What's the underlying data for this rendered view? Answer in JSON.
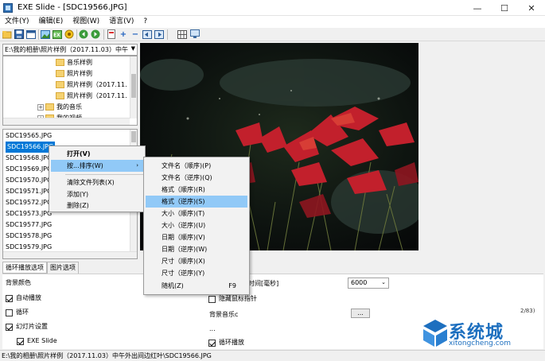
{
  "window": {
    "title": "EXE Slide - [SDC19566.JPG]",
    "minimize": "—",
    "maximize": "☐",
    "close": "✕"
  },
  "menubar": [
    "文件(Y)",
    "编辑(E)",
    "视图(W)",
    "语言(V)",
    "?"
  ],
  "toolbar": {
    "icons": [
      "open-folder-icon",
      "save-icon",
      "window-icon",
      "image-icon",
      "exe-icon",
      "record-icon",
      "back-icon",
      "forward-icon",
      "page-icon",
      "add-icon",
      "remove-icon",
      "move-left-icon",
      "move-right-icon",
      "grid-icon",
      "monitor-icon"
    ]
  },
  "path": {
    "value": "E:\\我的相册\\照片样例（2017.11.03）中午"
  },
  "tree": [
    {
      "label": "音乐样例"
    },
    {
      "label": "照片样例"
    },
    {
      "label": "照片样例（2017.11."
    },
    {
      "label": "照片样例（2017.11."
    },
    {
      "label": "我的音乐"
    },
    {
      "label": "我的视频"
    }
  ],
  "files": [
    "SDC19565.JPG",
    "SDC19566.JPG",
    "SDC19568.JPG",
    "SDC19569.JPG",
    "SDC19570.JPG",
    "SDC19571.JPG",
    "SDC19572.JPG",
    "SDC19573.JPG",
    "SDC19577.JPG",
    "SDC19578.JPG",
    "SDC19579.JPG"
  ],
  "tabs": [
    "循环播放选项",
    "图片选项"
  ],
  "options": {
    "bg_color": "背景颜色",
    "autoplay": "自动播放",
    "loop": "循环",
    "slideshow_settings": "幻灯片设置",
    "exe_slide": "EXE Slide",
    "interval_label": "时间[毫秒]",
    "interval_value": "6000",
    "hide_cursor": "隐藏鼠标指针",
    "bg_music": "背景音乐c",
    "dots": "...",
    "ellipsis": "...",
    "loop_play": "循环播放"
  },
  "context_menu": {
    "items": [
      "打开(V)",
      "按...排序(W)",
      "清除文件列表(X)",
      "添加(Y)",
      "删除(Z)"
    ],
    "submenu_arrow": "›"
  },
  "sort_submenu": {
    "items": [
      "文件名（顺序)(P)",
      "文件名（逆序)(Q)",
      "格式（顺序)(R)",
      "格式（逆序)(S)",
      "大小（顺序)(T)",
      "大小（逆序)(U)",
      "日期（顺序)(V)",
      "日期（逆序)(W)",
      "尺寸（顺序)(X)",
      "尺寸（逆序)(Y)",
      "随机(Z)"
    ],
    "random_shortcut": "F9"
  },
  "statusbar": {
    "text": "E:\\我的相册\\照片样例（2017.11.03）中午外出间边红叶\\SDC19566.JPG"
  },
  "page_counter": "2/83)",
  "watermark": {
    "text": "系统城",
    "sub": "xitongcheng.com"
  }
}
